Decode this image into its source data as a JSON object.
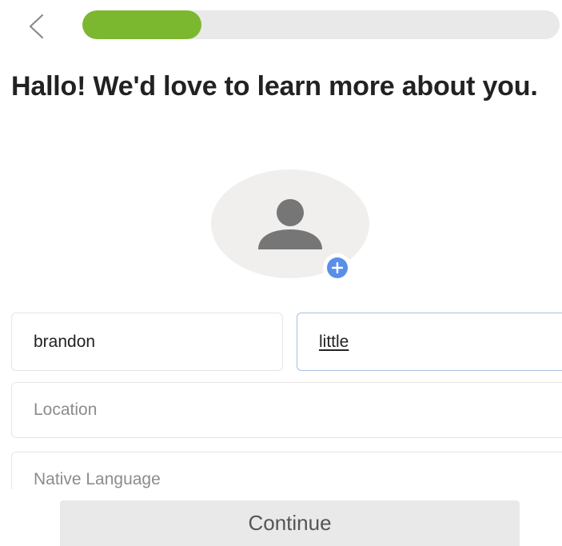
{
  "header": {
    "back_icon": "chevron-left-icon",
    "progress": 0.25,
    "progress_color": "#7cb82f"
  },
  "title": "Hallo! We'd love to learn more about you.",
  "avatar": {
    "icon": "person-icon",
    "add_icon": "plus-circle-icon",
    "add_color": "#5a8fe8"
  },
  "form": {
    "first_name": "brandon",
    "last_name": "little",
    "location_placeholder": "Location",
    "native_language_placeholder": "Native Language"
  },
  "continue_label": "Continue"
}
